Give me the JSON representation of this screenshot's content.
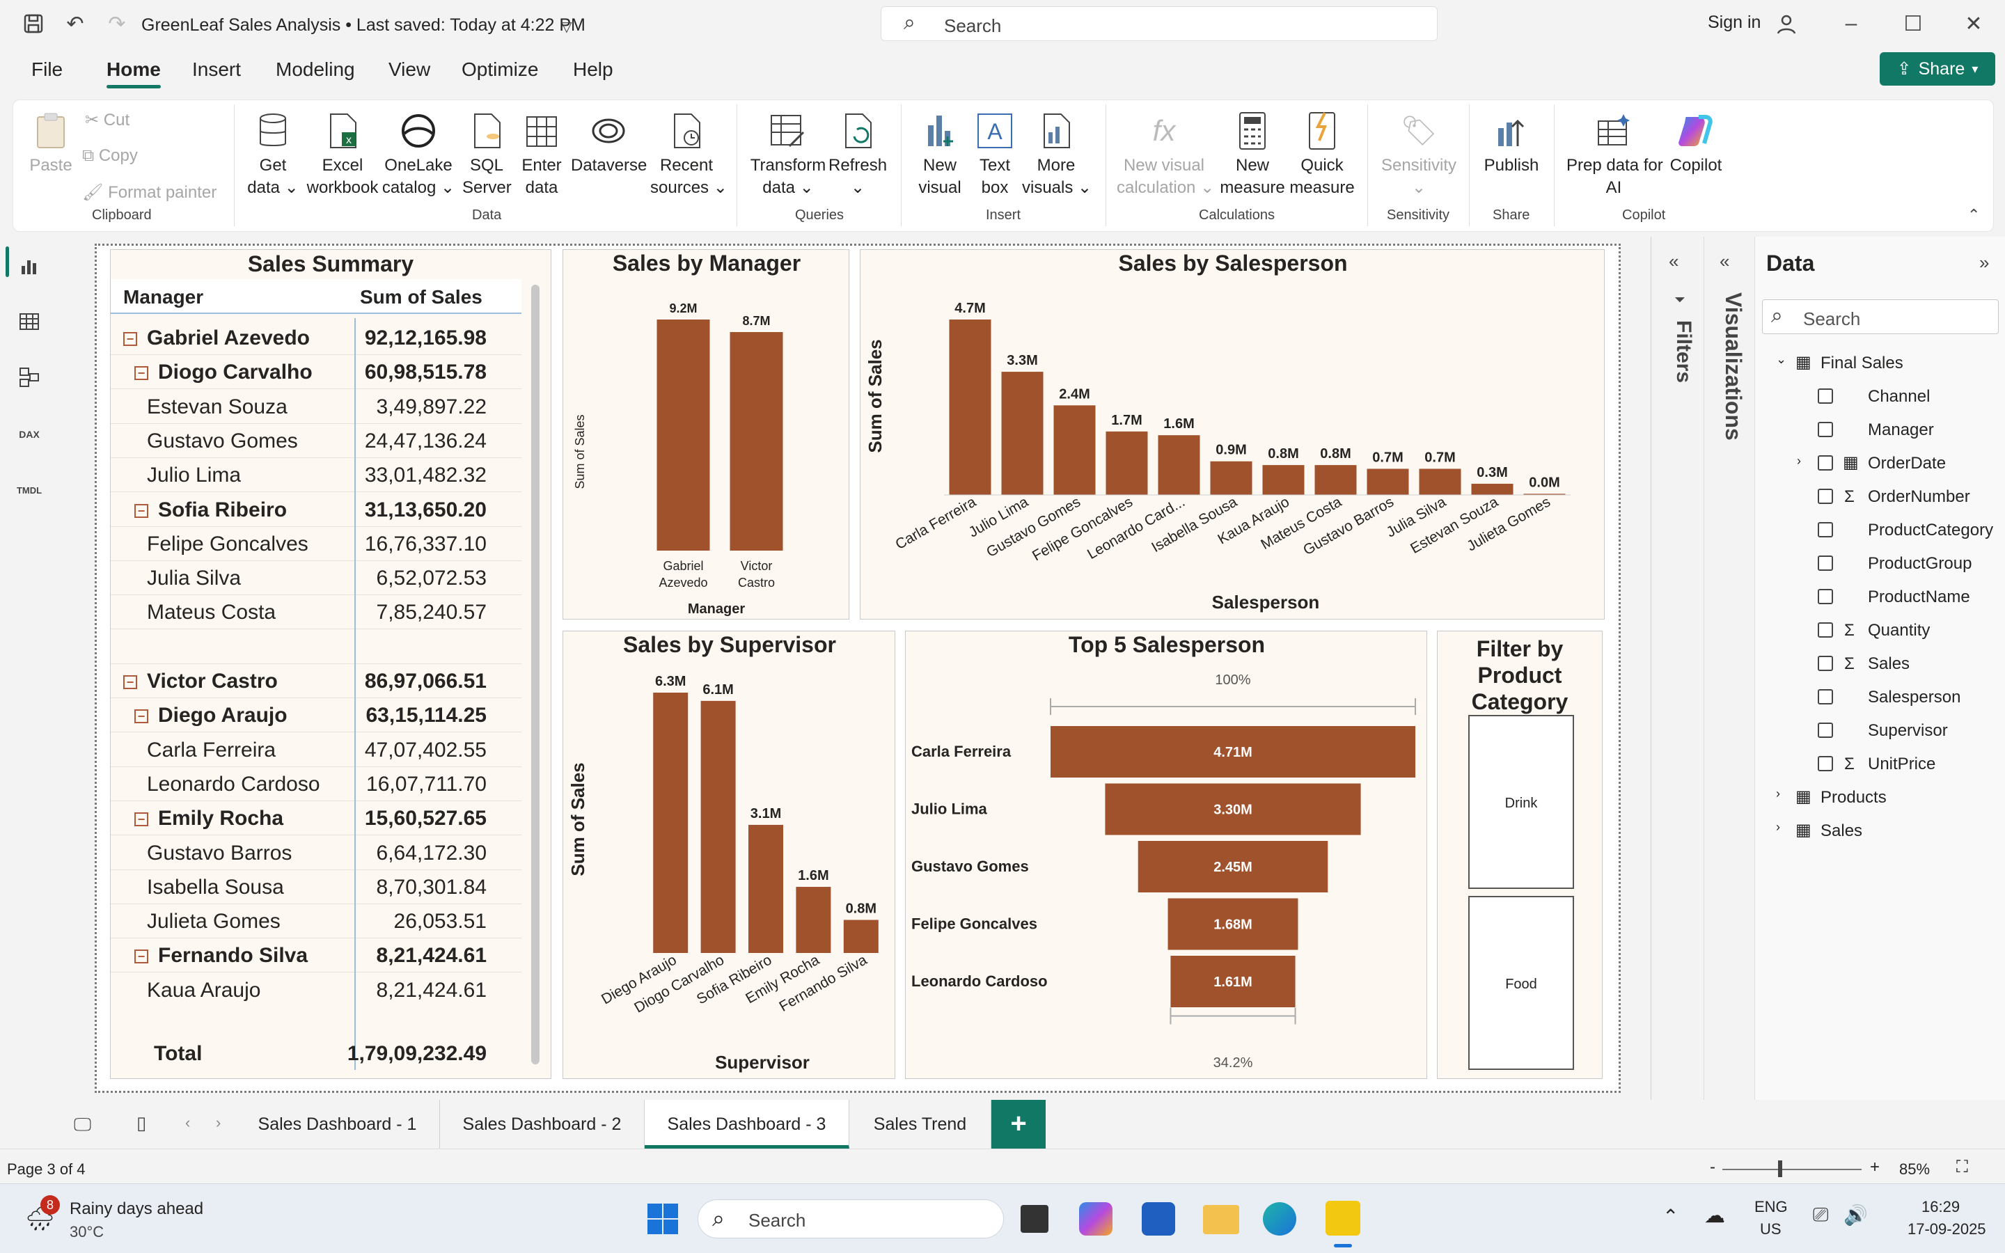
{
  "app": {
    "title": "GreenLeaf Sales Analysis • Last saved: Today at 4:22 PM",
    "search_placeholder": "Search",
    "sign_in": "Sign in",
    "share": "Share"
  },
  "menu": [
    "File",
    "Home",
    "Insert",
    "Modeling",
    "View",
    "Optimize",
    "Help"
  ],
  "ribbon": {
    "clipboard": {
      "paste": "Paste",
      "cut": "Cut",
      "copy": "Copy",
      "format_painter": "Format painter",
      "group": "Clipboard"
    },
    "data": {
      "get_data": [
        "Get",
        "data ⌄"
      ],
      "excel": [
        "Excel",
        "workbook"
      ],
      "onelake": [
        "OneLake",
        "catalog ⌄"
      ],
      "sql": [
        "SQL",
        "Server"
      ],
      "enter": [
        "Enter",
        "data"
      ],
      "dataverse": [
        "Dataverse",
        ""
      ],
      "recent": [
        "Recent",
        "sources ⌄"
      ],
      "group": "Data"
    },
    "queries": {
      "transform": [
        "Transform",
        "data ⌄"
      ],
      "refresh": [
        "Refresh",
        "⌄"
      ],
      "group": "Queries"
    },
    "insert": {
      "new_visual": [
        "New",
        "visual"
      ],
      "text_box": [
        "Text",
        "box"
      ],
      "more_visuals": [
        "More",
        "visuals ⌄"
      ],
      "group": "Insert"
    },
    "calculations": {
      "new_visual_calc": [
        "New visual",
        "calculation ⌄"
      ],
      "new_measure": [
        "New",
        "measure"
      ],
      "quick_measure": [
        "Quick",
        "measure"
      ],
      "group": "Calculations"
    },
    "sensitivity": {
      "label": [
        "Sensitivity",
        "⌄"
      ],
      "group": "Sensitivity"
    },
    "share": {
      "publish": [
        "Publish",
        ""
      ],
      "group": "Share"
    },
    "copilot": {
      "prep": [
        "Prep data for",
        "AI"
      ],
      "copilot": [
        "Copilot",
        ""
      ],
      "group": "Copilot"
    }
  },
  "sales_summary": {
    "title": "Sales Summary",
    "col_manager": "Manager",
    "col_sales": "Sum of Sales",
    "rows": [
      {
        "name": "Gabriel Azevedo",
        "value": "92,12,165.98",
        "level": 0
      },
      {
        "name": "Diogo Carvalho",
        "value": "60,98,515.78",
        "level": 1
      },
      {
        "name": "Estevan Souza",
        "value": "3,49,897.22",
        "level": 2
      },
      {
        "name": "Gustavo Gomes",
        "value": "24,47,136.24",
        "level": 2
      },
      {
        "name": "Julio Lima",
        "value": "33,01,482.32",
        "level": 2
      },
      {
        "name": "Sofia Ribeiro",
        "value": "31,13,650.20",
        "level": 1
      },
      {
        "name": "Felipe Goncalves",
        "value": "16,76,337.10",
        "level": 2
      },
      {
        "name": "Julia Silva",
        "value": "6,52,072.53",
        "level": 2
      },
      {
        "name": "Mateus Costa",
        "value": "7,85,240.57",
        "level": 2
      },
      {
        "name": "",
        "value": "",
        "level": 2
      },
      {
        "name": "Victor Castro",
        "value": "86,97,066.51",
        "level": 0
      },
      {
        "name": "Diego Araujo",
        "value": "63,15,114.25",
        "level": 1
      },
      {
        "name": "Carla Ferreira",
        "value": "47,07,402.55",
        "level": 2
      },
      {
        "name": "Leonardo Cardoso",
        "value": "16,07,711.70",
        "level": 2
      },
      {
        "name": "Emily Rocha",
        "value": "15,60,527.65",
        "level": 1
      },
      {
        "name": "Gustavo Barros",
        "value": "6,64,172.30",
        "level": 2
      },
      {
        "name": "Isabella Sousa",
        "value": "8,70,301.84",
        "level": 2
      },
      {
        "name": "Julieta Gomes",
        "value": "26,053.51",
        "level": 2
      },
      {
        "name": "Fernando Silva",
        "value": "8,21,424.61",
        "level": 1
      },
      {
        "name": "Kaua Araujo",
        "value": "8,21,424.61",
        "level": 2
      }
    ],
    "total_label": "Total",
    "total_value": "1,79,09,232.49"
  },
  "chart_data": [
    {
      "type": "bar",
      "title": "Sales by Manager",
      "xlabel": "Manager",
      "ylabel": "Sum of Sales",
      "categories": [
        "Gabriel Azevedo",
        "Victor Castro"
      ],
      "values": [
        9.2,
        8.7
      ],
      "data_labels": [
        "9.2M",
        "8.7M"
      ],
      "unit": "M"
    },
    {
      "type": "bar",
      "title": "Sales by Salesperson",
      "xlabel": "Salesperson",
      "ylabel": "Sum of Sales",
      "categories": [
        "Carla Ferreira",
        "Julio Lima",
        "Gustavo Gomes",
        "Felipe Goncalves",
        "Leonardo Card...",
        "Isabella Sousa",
        "Kaua Araujo",
        "Mateus Costa",
        "Gustavo Barros",
        "Julia Silva",
        "Estevan Souza",
        "Julieta Gomes"
      ],
      "values": [
        4.7,
        3.3,
        2.4,
        1.7,
        1.6,
        0.9,
        0.8,
        0.8,
        0.7,
        0.7,
        0.3,
        0.03
      ],
      "data_labels": [
        "4.7M",
        "3.3M",
        "2.4M",
        "1.7M",
        "1.6M",
        "0.9M",
        "0.8M",
        "0.8M",
        "0.7M",
        "0.7M",
        "0.3M",
        "0.0M"
      ],
      "unit": "M"
    },
    {
      "type": "bar",
      "title": "Sales by Supervisor",
      "xlabel": "Supervisor",
      "ylabel": "Sum of Sales",
      "categories": [
        "Diego Araujo",
        "Diogo Carvalho",
        "Sofia Ribeiro",
        "Emily Rocha",
        "Fernando Silva"
      ],
      "values": [
        6.3,
        6.1,
        3.1,
        1.6,
        0.8
      ],
      "data_labels": [
        "6.3M",
        "6.1M",
        "3.1M",
        "1.6M",
        "0.8M"
      ],
      "unit": "M"
    },
    {
      "type": "funnel",
      "title": "Top 5 Salesperson",
      "categories": [
        "Carla Ferreira",
        "Julio Lima",
        "Gustavo Gomes",
        "Felipe Goncalves",
        "Leonardo Cardoso"
      ],
      "values": [
        4.71,
        3.3,
        2.45,
        1.68,
        1.61
      ],
      "data_labels": [
        "4.71M",
        "3.30M",
        "2.45M",
        "1.68M",
        "1.61M"
      ],
      "top_percent": "100%",
      "bottom_percent": "34.2%"
    }
  ],
  "slicer": {
    "title": "Filter by Product Category",
    "options": [
      "Drink",
      "Food"
    ]
  },
  "panes": {
    "filters": "Filters",
    "visualizations": "Visualizations",
    "data_title": "Data",
    "data_search": "Search"
  },
  "fields": {
    "table": "Final Sales",
    "items": [
      {
        "name": "Channel",
        "sigma": false,
        "cal": false,
        "expand": false
      },
      {
        "name": "Manager",
        "sigma": false,
        "cal": false,
        "expand": false
      },
      {
        "name": "OrderDate",
        "sigma": false,
        "cal": true,
        "expand": true
      },
      {
        "name": "OrderNumber",
        "sigma": true,
        "cal": false,
        "expand": false
      },
      {
        "name": "ProductCategory",
        "sigma": false,
        "cal": false,
        "expand": false
      },
      {
        "name": "ProductGroup",
        "sigma": false,
        "cal": false,
        "expand": false
      },
      {
        "name": "ProductName",
        "sigma": false,
        "cal": false,
        "expand": false
      },
      {
        "name": "Quantity",
        "sigma": true,
        "cal": false,
        "expand": false
      },
      {
        "name": "Sales",
        "sigma": true,
        "cal": false,
        "expand": false
      },
      {
        "name": "Salesperson",
        "sigma": false,
        "cal": false,
        "expand": false
      },
      {
        "name": "Supervisor",
        "sigma": false,
        "cal": false,
        "expand": false
      },
      {
        "name": "UnitPrice",
        "sigma": true,
        "cal": false,
        "expand": false
      }
    ],
    "other_tables": [
      "Products",
      "Sales"
    ]
  },
  "tabs": [
    "Sales Dashboard - 1",
    "Sales Dashboard - 2",
    "Sales Dashboard - 3",
    "Sales Trend"
  ],
  "active_tab": 2,
  "status": {
    "page": "Page 3 of 4",
    "zoom": "85%"
  },
  "taskbar": {
    "weather_title": "Rainy days ahead",
    "weather_temp": "30°C",
    "badge": "8",
    "search": "Search",
    "lang1": "ENG",
    "lang2": "US",
    "time": "16:29",
    "date": "17-09-2025"
  },
  "colors": {
    "bar": "#a0522d",
    "accent": "#117865",
    "visual_bg": "#fdf8f1"
  }
}
